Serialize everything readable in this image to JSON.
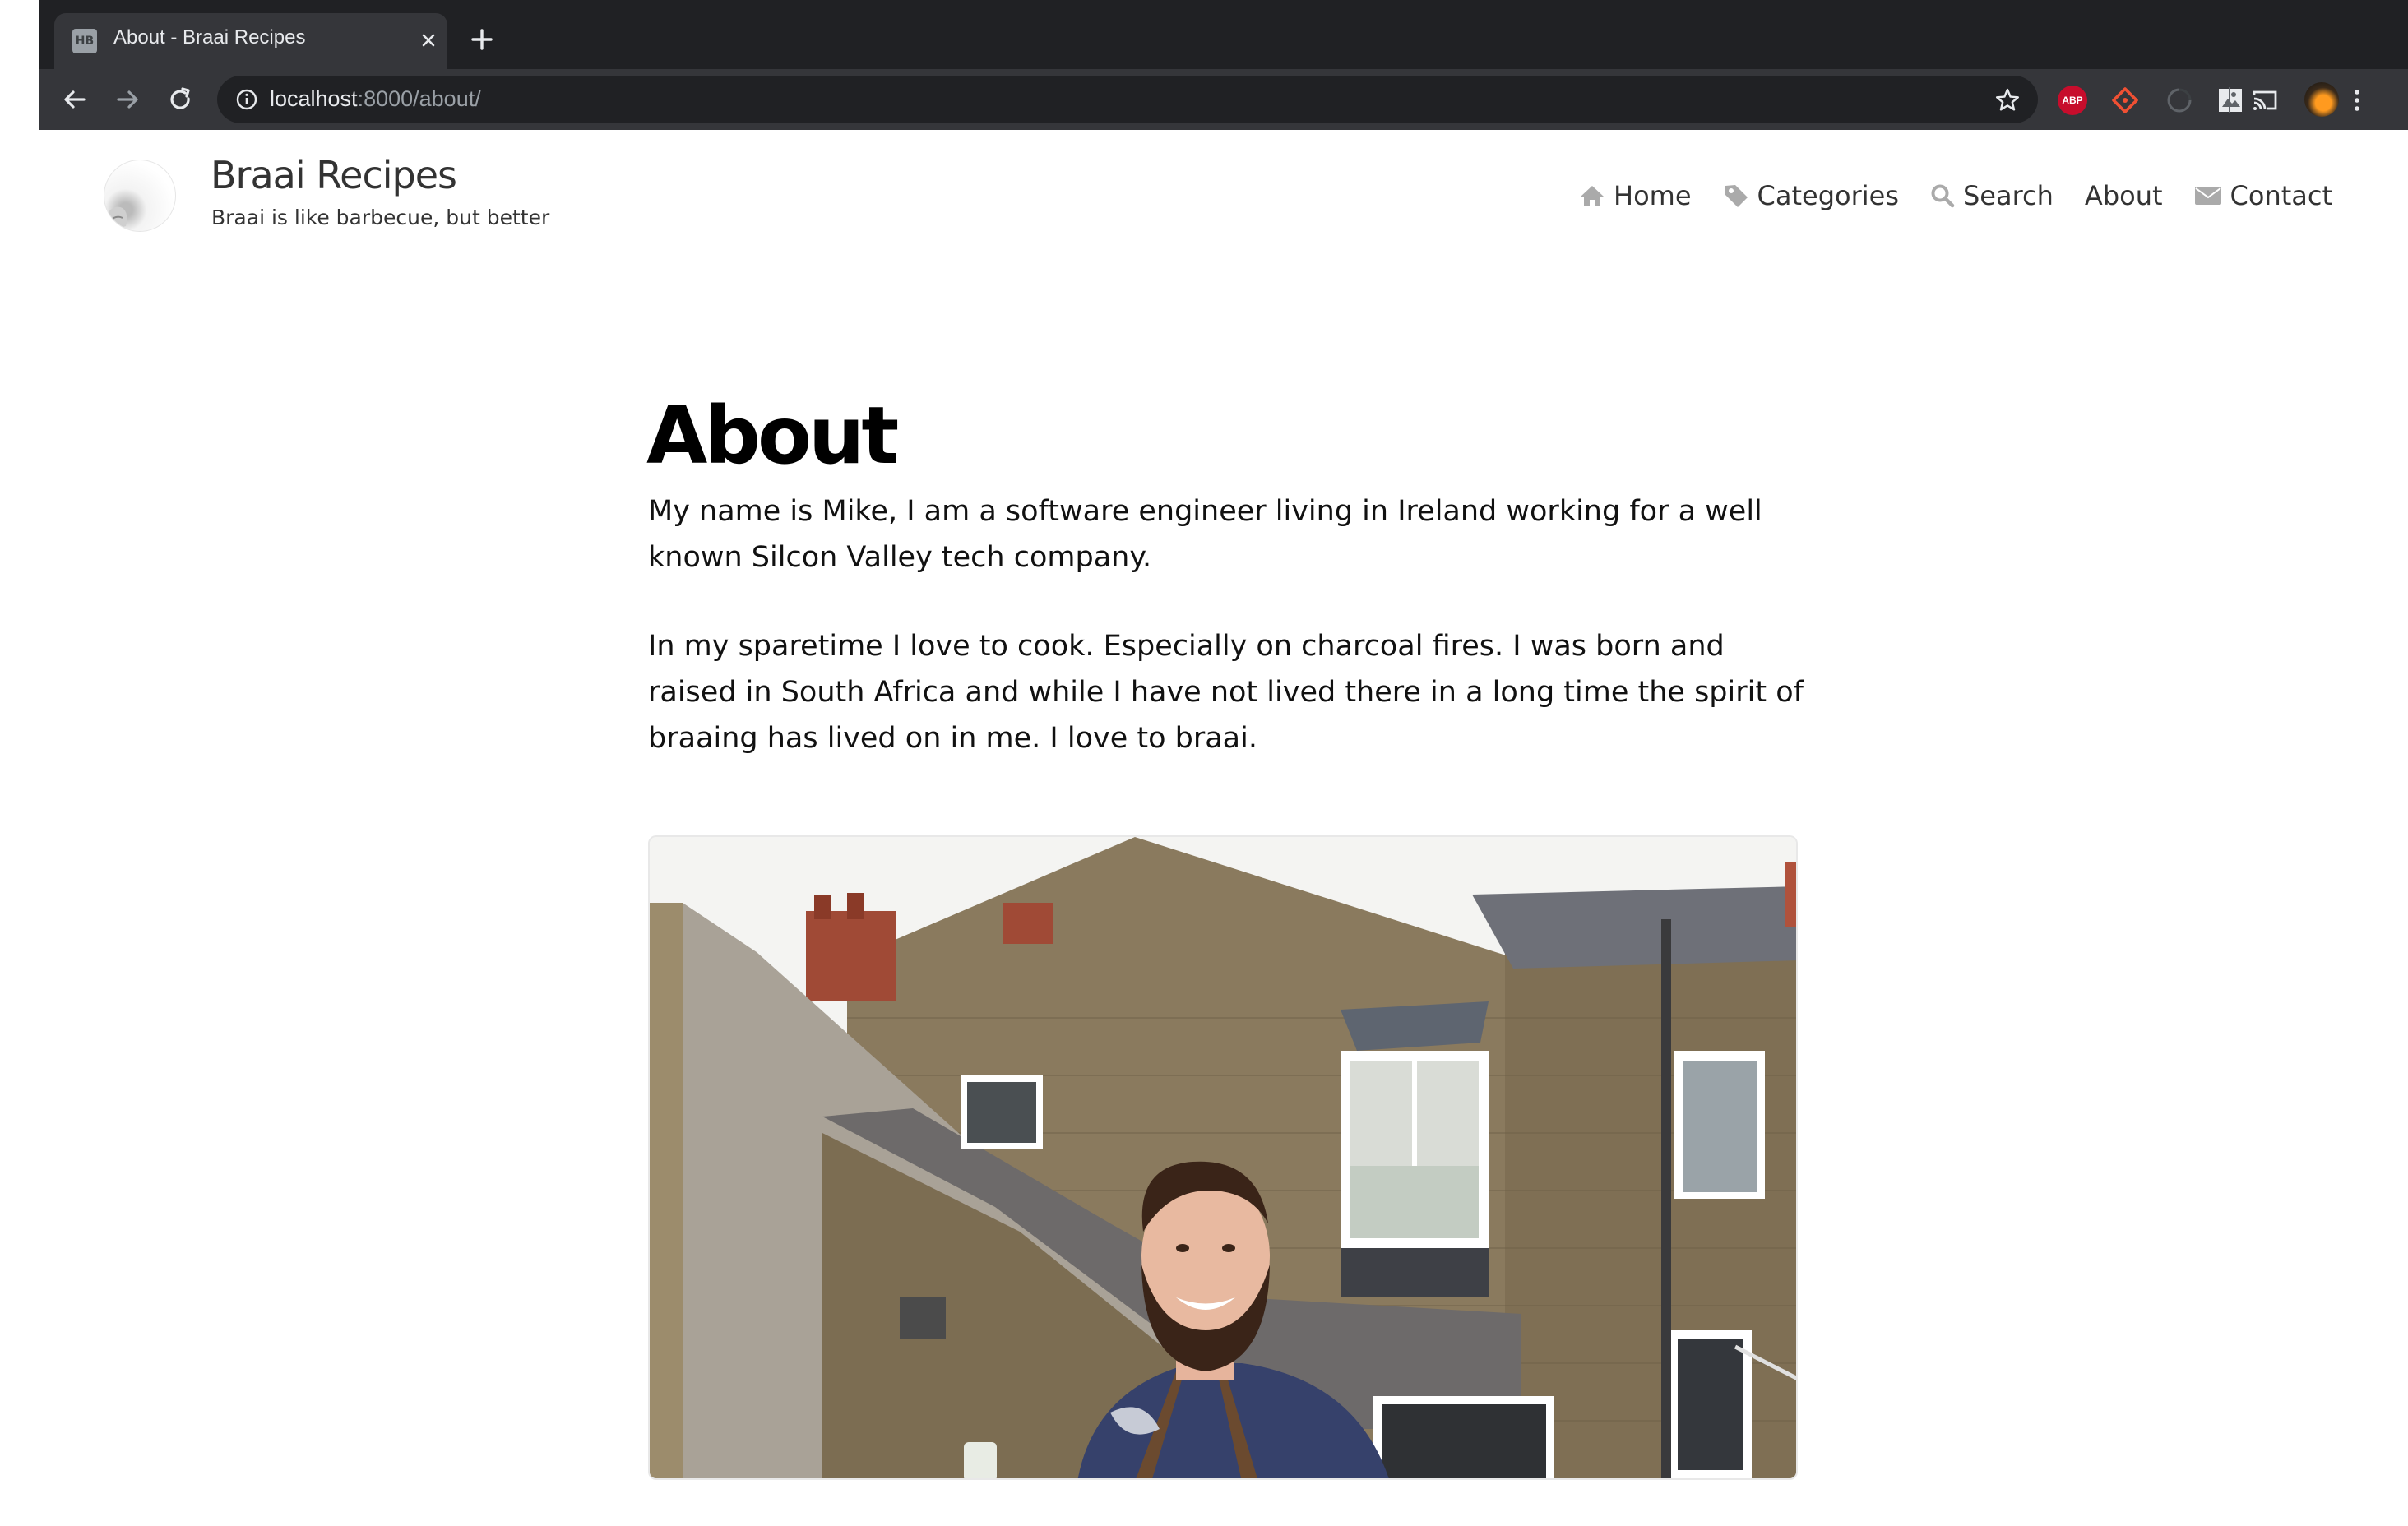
{
  "browser": {
    "tab": {
      "title": "About - Braai Recipes",
      "favicon": "HB"
    },
    "address": {
      "host": "localhost",
      "path": ":8000/about/"
    },
    "icons": [
      "back-icon",
      "forward-icon",
      "reload-icon",
      "info-icon",
      "star-icon",
      "adblock-plus-icon",
      "git-extension-icon",
      "loading-extension-icon",
      "image-extension-icon",
      "cast-icon",
      "profile-avatar",
      "menu-icon"
    ],
    "abp_label": "ABP"
  },
  "site": {
    "title": "Braai Recipes",
    "tagline": "Braai is like barbecue, but better"
  },
  "nav": {
    "items": [
      {
        "label": "Home",
        "icon": "home-icon"
      },
      {
        "label": "Categories",
        "icon": "tag-icon"
      },
      {
        "label": "Search",
        "icon": "search-icon"
      },
      {
        "label": "About",
        "icon": ""
      },
      {
        "label": "Contact",
        "icon": "envelope-icon"
      }
    ]
  },
  "page": {
    "title": "About",
    "paragraphs": [
      "My name is Mike, I am a software engineer living in Ireland working for a well known Silcon Valley tech company.",
      "In my sparetime I love to cook. Especially on charcoal fires. I was born and raised in South Africa and while I have not lived there in a long time the spirit of braaing has lived on in me. I love to braai."
    ]
  },
  "colors": {
    "chrome_dark": "#202124",
    "chrome_toolbar": "#35363a",
    "text": "#333333",
    "nav_icon": "#aaaaaa"
  }
}
